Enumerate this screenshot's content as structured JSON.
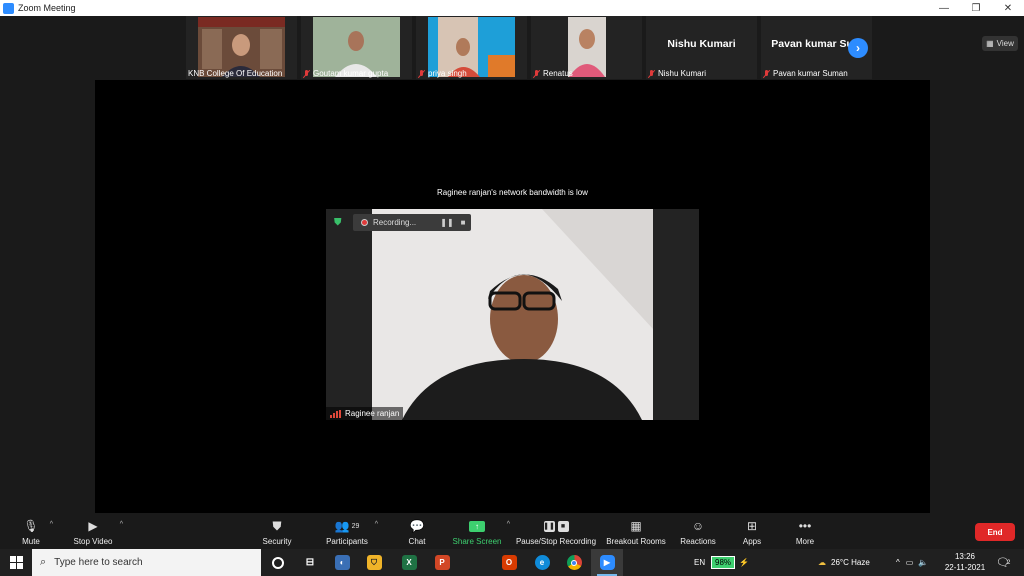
{
  "window": {
    "title": "Zoom Meeting",
    "controls": [
      "—",
      "❐",
      "✕"
    ]
  },
  "view_button": "View",
  "participants_strip": [
    {
      "name": "KNB College Of Education",
      "muted": false,
      "has_video": true
    },
    {
      "name": "Goutam kumar gupta",
      "muted": true,
      "has_video": true
    },
    {
      "name": "priya singh",
      "muted": true,
      "has_video": true
    },
    {
      "name": "Renatus",
      "muted": true,
      "has_video": true
    },
    {
      "name": "Nishu Kumari",
      "display_name": "Nishu Kumari",
      "muted": true,
      "has_video": false
    },
    {
      "name": "Pavan kumar Suman",
      "display_name": "Pavan kumar Su...",
      "muted": true,
      "has_video": false
    }
  ],
  "main": {
    "bandwidth_notice": "Raginee ranjan's network bandwidth is low",
    "recording_label": "Recording...",
    "speaker_name": "Raginee ranjan"
  },
  "toolbar": {
    "mute": "Mute",
    "stop_video": "Stop Video",
    "security": "Security",
    "participants": "Participants",
    "participants_count": "29",
    "chat": "Chat",
    "share_screen": "Share Screen",
    "pause_stop_recording": "Pause/Stop Recording",
    "breakout_rooms": "Breakout Rooms",
    "reactions": "Reactions",
    "apps": "Apps",
    "more": "More",
    "end": "End"
  },
  "taskbar": {
    "search_placeholder": "Type here to search",
    "language": "EN",
    "battery": "98%",
    "weather": "26°C  Haze",
    "time": "13:26",
    "date": "22-11-2021",
    "notifications": "2"
  },
  "colors": {
    "accent": "#2d8cff",
    "end": "#e02828",
    "share": "#3dcf6f",
    "muted": "#e03a3a"
  }
}
